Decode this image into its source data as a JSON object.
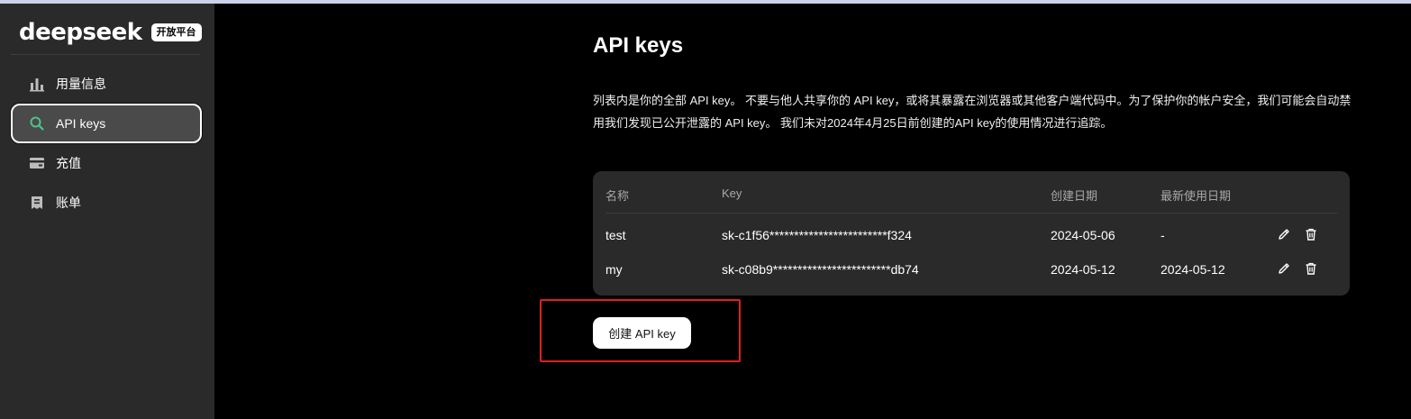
{
  "brand": {
    "name": "deepseek",
    "badge": "开放平台"
  },
  "sidebar": {
    "items": [
      {
        "label": "用量信息",
        "icon": "bar-chart-icon",
        "active": false
      },
      {
        "label": "API keys",
        "icon": "search-icon",
        "active": true
      },
      {
        "label": "充值",
        "icon": "wallet-icon",
        "active": false
      },
      {
        "label": "账单",
        "icon": "invoice-icon",
        "active": false
      }
    ]
  },
  "main": {
    "title": "API keys",
    "description": "列表内是你的全部 API key。 不要与他人共享你的 API key，或将其暴露在浏览器或其他客户端代码中。为了保护你的帐户安全，我们可能会自动禁用我们发现已公开泄露的 API key。 我们未对2024年4月25日前创建的API key的使用情况进行追踪。",
    "table": {
      "headers": {
        "name": "名称",
        "key": "Key",
        "created": "创建日期",
        "last_used": "最新使用日期"
      },
      "rows": [
        {
          "name": "test",
          "key": "sk-c1f56************************f324",
          "created": "2024-05-06",
          "last_used": "-"
        },
        {
          "name": "my",
          "key": "sk-c08b9************************db74",
          "created": "2024-05-12",
          "last_used": "2024-05-12"
        }
      ]
    },
    "create_button": "创建 API key"
  },
  "colors": {
    "background": "#000000",
    "sidebar": "#2a2a2a",
    "card": "#2a2a2a",
    "active_item": "#4a4a4a",
    "accent_green": "#4cc38a",
    "highlight_red": "#e02020"
  }
}
